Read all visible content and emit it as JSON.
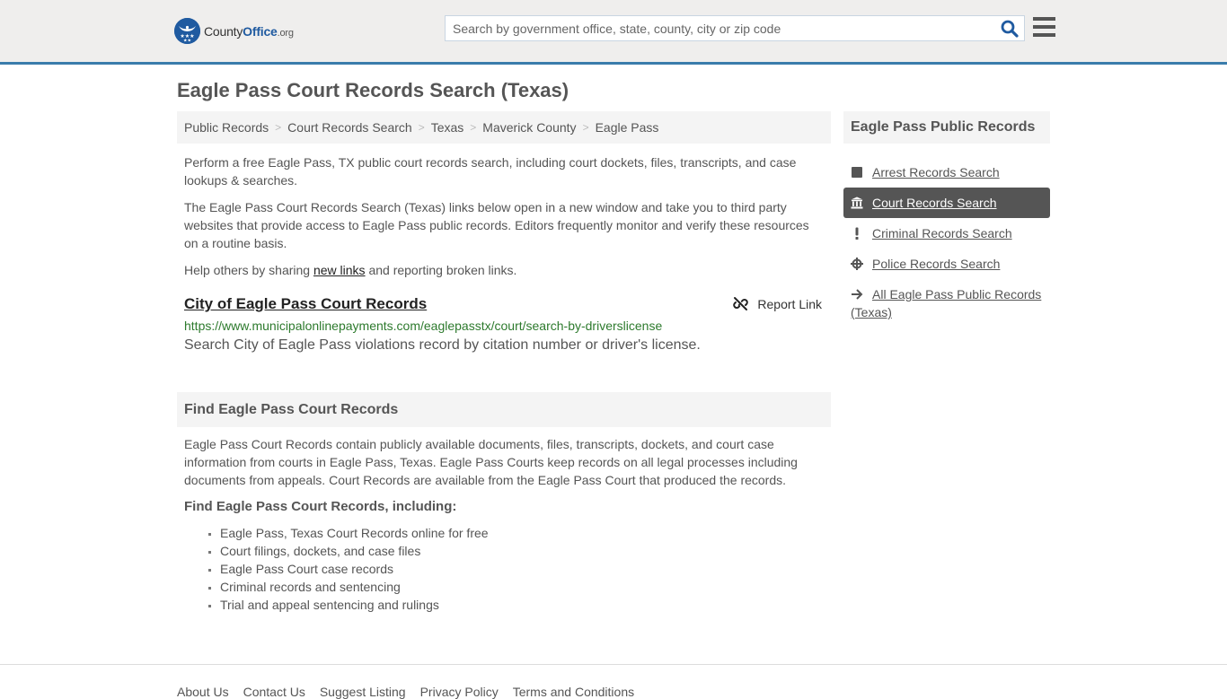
{
  "header": {
    "logo": {
      "county": "County",
      "office": "Office",
      "org": ".org"
    },
    "search": {
      "placeholder": "Search by government office, state, county, city or zip code",
      "value": ""
    },
    "icons": {
      "search": "search-icon",
      "menu": "hamburger-menu-icon"
    },
    "accent_color": "#3a7cab"
  },
  "page": {
    "title": "Eagle Pass Court Records Search (Texas)"
  },
  "breadcrumb": [
    {
      "label": "Public Records"
    },
    {
      "label": "Court Records Search"
    },
    {
      "label": "Texas"
    },
    {
      "label": "Maverick County"
    },
    {
      "label": "Eagle Pass"
    }
  ],
  "intro": {
    "p1": "Perform a free Eagle Pass, TX public court records search, including court dockets, files, transcripts, and case lookups & searches.",
    "p2": "The Eagle Pass Court Records Search (Texas) links below open in a new window and take you to third party websites that provide access to Eagle Pass public records. Editors frequently monitor and verify these resources on a routine basis.",
    "p3_before": "Help others by sharing ",
    "p3_link": "new links",
    "p3_after": " and reporting broken links."
  },
  "records": [
    {
      "title": "City of Eagle Pass Court Records",
      "url": "https://www.municipalonlinepayments.com/eaglepasstx/court/search-by-driverslicense",
      "description": "Search City of Eagle Pass violations record by citation number or driver's license.",
      "report_label": "Report Link"
    }
  ],
  "find_section": {
    "heading": "Find Eagle Pass Court Records",
    "body": "Eagle Pass Court Records contain publicly available documents, files, transcripts, dockets, and court case information from courts in Eagle Pass, Texas. Eagle Pass Courts keep records on all legal processes including documents from appeals. Court Records are available from the Eagle Pass Court that produced the records.",
    "subheading": "Find Eagle Pass Court Records, including:",
    "items": [
      "Eagle Pass, Texas Court Records online for free",
      "Court filings, dockets, and case files",
      "Eagle Pass Court case records",
      "Criminal records and sentencing",
      "Trial and appeal sentencing and rulings"
    ]
  },
  "sidebar": {
    "heading": "Eagle Pass Public Records",
    "items": [
      {
        "label": "Arrest Records Search",
        "icon": "square-icon",
        "active": false
      },
      {
        "label": "Court Records Search",
        "icon": "courthouse-icon",
        "active": true
      },
      {
        "label": "Criminal Records Search",
        "icon": "exclamation-icon",
        "active": false
      },
      {
        "label": "Police Records Search",
        "icon": "crosshairs-icon",
        "active": false
      },
      {
        "label": "All Eagle Pass Public Records (Texas)",
        "icon": "arrow-right-icon",
        "active": false
      }
    ]
  },
  "footer": {
    "links": [
      "About Us",
      "Contact Us",
      "Suggest Listing",
      "Privacy Policy",
      "Terms and Conditions"
    ]
  }
}
